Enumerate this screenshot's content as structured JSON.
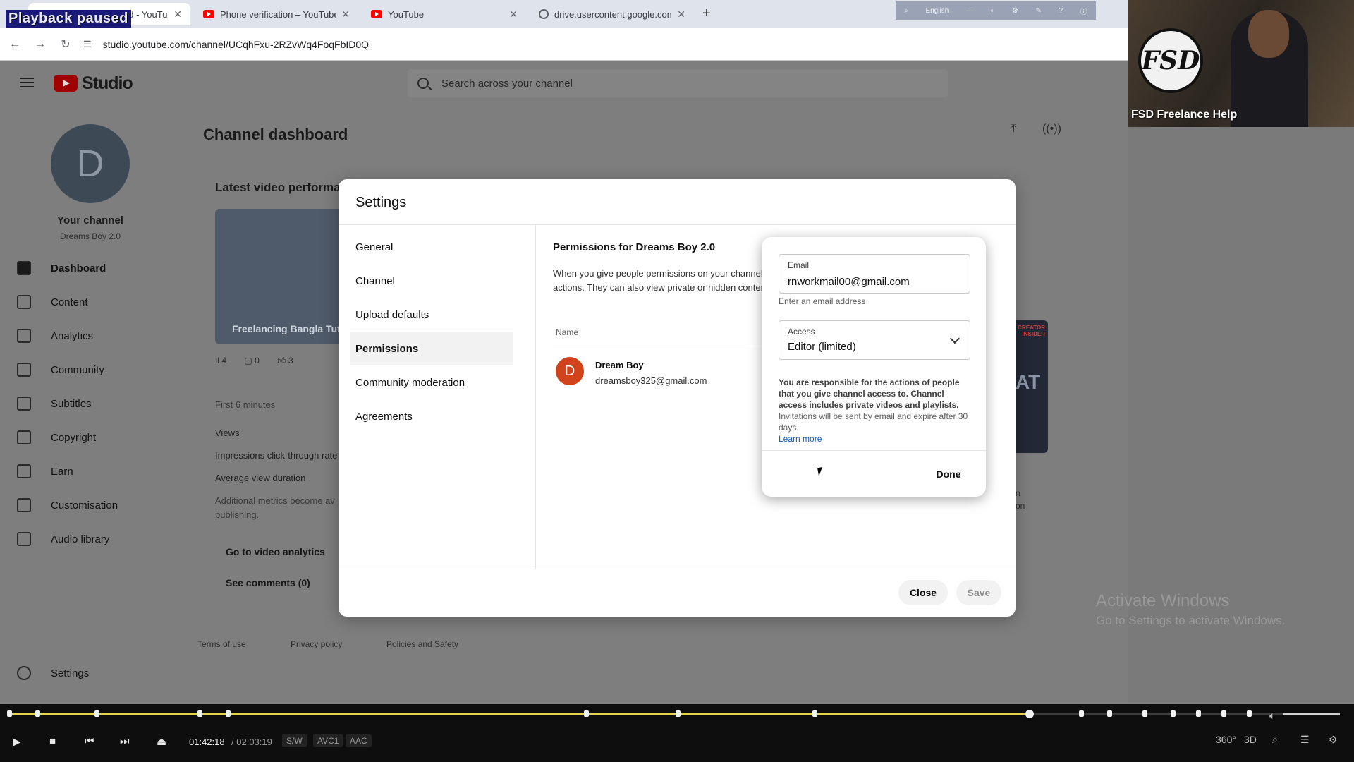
{
  "browser": {
    "overlay_label": "Playback paused",
    "tabs": [
      {
        "title": "Channel dashboard - YouTube S",
        "icon": "youtube-favicon-icon",
        "active": true
      },
      {
        "title": "Phone verification – YouTube",
        "icon": "youtube-favicon-icon",
        "active": false
      },
      {
        "title": "YouTube",
        "icon": "youtube-favicon-icon",
        "active": false
      },
      {
        "title": "drive.usercontent.google.com",
        "icon": "globe-icon",
        "active": false
      }
    ],
    "new_tab": "+",
    "close_glyph": "✕",
    "url": "studio.youtube.com/channel/UCqhFxu-2RZvWq4FoqFbID0Q",
    "mini_toolbar_lang": "English"
  },
  "webcam": {
    "logo_text": "FSD",
    "caption": "FSD Freelance Help"
  },
  "studio": {
    "logo_text": "Studio",
    "search_placeholder": "Search across your channel",
    "channel": {
      "initial": "D",
      "title": "Your channel",
      "name": "Dreams Boy 2.0"
    },
    "nav": [
      {
        "label": "Dashboard",
        "active": true
      },
      {
        "label": "Content",
        "active": false
      },
      {
        "label": "Analytics",
        "active": false
      },
      {
        "label": "Community",
        "active": false
      },
      {
        "label": "Subtitles",
        "active": false
      },
      {
        "label": "Copyright",
        "active": false
      },
      {
        "label": "Earn",
        "active": false
      },
      {
        "label": "Customisation",
        "active": false
      },
      {
        "label": "Audio library",
        "active": false
      }
    ],
    "settings_label": "Settings",
    "page_title": "Channel dashboard",
    "card_title": "Latest video performa",
    "video_thumb_text": "Freelancing Bangla Tut",
    "stats": {
      "views": "4",
      "comments": "0",
      "likes": "3"
    },
    "first_minutes": "First 6 minutes",
    "metric_views": "Views",
    "metric_ctr": "Impressions click-through rate",
    "metric_avd": "Average view duration",
    "metrics_note_1": "Additional metrics become av",
    "metrics_note_2": "publishing.",
    "go_to_analytics": "Go to video analytics",
    "see_comments": "See comments (0)",
    "footer": [
      "Terms of use",
      "Privacy policy",
      "Policies and Safety"
    ],
    "creator_badge": "CREATOR INSIDER",
    "creator_letters": "AT",
    "side_fragment_1": "n",
    "side_fragment_2": "on"
  },
  "settings_dialog": {
    "title": "Settings",
    "nav": [
      {
        "label": "General",
        "active": false
      },
      {
        "label": "Channel",
        "active": false
      },
      {
        "label": "Upload defaults",
        "active": false
      },
      {
        "label": "Permissions",
        "active": true
      },
      {
        "label": "Community moderation",
        "active": false
      },
      {
        "label": "Agreements",
        "active": false
      }
    ],
    "permissions_title": "Permissions for Dreams Boy 2.0",
    "permissions_desc_1": "When you give people permissions on your channel,",
    "permissions_desc_2": "actions. They can also view private or hidden conter",
    "column_name": "Name",
    "user": {
      "initial": "D",
      "name": "Dream Boy",
      "email": "dreamsboy325@gmail.com"
    },
    "close_button": "Close",
    "save_button": "Save"
  },
  "invite_popup": {
    "email_label": "Email",
    "email_value": "rnworkmail00@gmail.com",
    "email_hint": "Enter an email address",
    "access_label": "Access",
    "access_value": "Editor (limited)",
    "notice_bold": "You are responsible for the actions of people that you give channel access to. Channel access includes private videos and playlists.",
    "notice_rest": " Invitations will be sent by email and expire after 30 days.",
    "learn_more": "Learn more",
    "done_button": "Done"
  },
  "windows_watermark": {
    "line1": "Activate Windows",
    "line2": "Go to Settings to activate Windows."
  },
  "player": {
    "current_time": "01:42:18",
    "separator": "/",
    "total_time": "02:03:19",
    "codecs": [
      "S/W",
      "AVC1",
      "AAC"
    ],
    "progress_fraction": 0.7674,
    "volume_fraction": 1.0,
    "right_controls": [
      "360°",
      "3D"
    ]
  },
  "colors": {
    "youtube_red": "#ff0000",
    "link_blue": "#065fd4",
    "seek_yellow": "#e8d44a",
    "user_avatar": "#d1431a"
  }
}
